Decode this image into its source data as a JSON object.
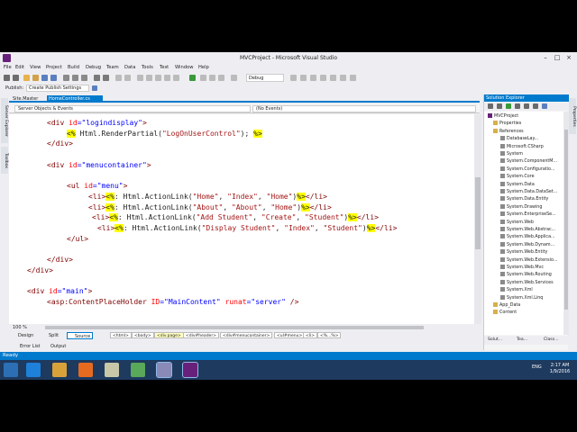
{
  "window": {
    "title": "MVCProject - Microsoft Visual Studio",
    "controls": [
      "–",
      "□",
      "×"
    ]
  },
  "menu": [
    "File",
    "Edit",
    "View",
    "Project",
    "Build",
    "Debug",
    "Team",
    "Data",
    "Tools",
    "Test",
    "Window",
    "Help"
  ],
  "toolbar": {
    "config_value": "Debug",
    "publish_label": "Publish:",
    "publish_profile": "Create Publish Settings"
  },
  "left_strip_tabs": [
    "Server Explorer",
    "Toolbox"
  ],
  "doc_tabs": [
    "Site.Master",
    "HomeController.cs"
  ],
  "navbar": {
    "left": "Server Objects & Events",
    "right": "(No Events)"
  },
  "code": {
    "lines": [
      {
        "tokens": [
          [
            "t",
            "<div "
          ],
          [
            "a",
            "id"
          ],
          [
            "v",
            "=\"logindisplay\""
          ],
          [
            "t",
            ">"
          ]
        ]
      },
      {
        "tokens": [
          [
            "hl",
            "<%"
          ],
          [
            "pl",
            " Html.RenderPartial("
          ],
          [
            "s",
            "\"LogOnUserControl\""
          ],
          [
            "pl",
            "); "
          ],
          [
            "hl",
            "%>"
          ]
        ]
      },
      {
        "tokens": [
          [
            "t",
            "</div>"
          ]
        ]
      },
      {
        "tokens": []
      },
      {
        "tokens": [
          [
            "t",
            "<div "
          ],
          [
            "a",
            "id"
          ],
          [
            "v",
            "=\"menucontainer\""
          ],
          [
            "t",
            ">"
          ]
        ]
      },
      {
        "tokens": []
      },
      {
        "tokens": [
          [
            "t",
            "<ul "
          ],
          [
            "a",
            "id"
          ],
          [
            "v",
            "=\"menu\""
          ],
          [
            "t",
            ">"
          ]
        ]
      },
      {
        "tokens": [
          [
            "t",
            "<li>"
          ],
          [
            "hl",
            "<%"
          ],
          [
            "pl",
            ": Html.ActionLink("
          ],
          [
            "s",
            "\"Home\""
          ],
          [
            "pl",
            ", "
          ],
          [
            "s",
            "\"Index\""
          ],
          [
            "pl",
            ", "
          ],
          [
            "s",
            "\"Home\""
          ],
          [
            "pl",
            ")"
          ],
          [
            "hl",
            "%>"
          ],
          [
            "t",
            "</li>"
          ]
        ]
      },
      {
        "tokens": [
          [
            "t",
            "<li>"
          ],
          [
            "hl",
            "<%"
          ],
          [
            "pl",
            ": Html.ActionLink("
          ],
          [
            "s",
            "\"About\""
          ],
          [
            "pl",
            ", "
          ],
          [
            "s",
            "\"About\""
          ],
          [
            "pl",
            ", "
          ],
          [
            "s",
            "\"Home\""
          ],
          [
            "pl",
            ")"
          ],
          [
            "hl",
            "%>"
          ],
          [
            "t",
            "</li>"
          ]
        ]
      },
      {
        "tokens": [
          [
            "t",
            "<li>"
          ],
          [
            "hl",
            "<%"
          ],
          [
            "pl",
            ": Html.ActionLink("
          ],
          [
            "s",
            "\"Add Student\""
          ],
          [
            "pl",
            ", "
          ],
          [
            "s",
            "\"Create\""
          ],
          [
            "pl",
            ", "
          ],
          [
            "s",
            "\"Student\""
          ],
          [
            "pl",
            ")"
          ],
          [
            "hl",
            "%>"
          ],
          [
            "t",
            "</li>"
          ]
        ]
      },
      {
        "tokens": [
          [
            "t",
            "<li>"
          ],
          [
            "hl",
            "<%"
          ],
          [
            "pl",
            ": Html.ActionLink("
          ],
          [
            "s",
            "\"Display Student\""
          ],
          [
            "pl",
            ", "
          ],
          [
            "s",
            "\"Index\""
          ],
          [
            "pl",
            ", "
          ],
          [
            "s",
            "\"Student\""
          ],
          [
            "pl",
            ")"
          ],
          [
            "hl",
            "%>"
          ],
          [
            "t",
            "</li>"
          ]
        ]
      },
      {
        "tokens": [
          [
            "t",
            "</ul>"
          ]
        ]
      },
      {
        "tokens": []
      },
      {
        "tokens": [
          [
            "t",
            "</div>"
          ]
        ]
      },
      {
        "tokens": [
          [
            "t",
            "</div>"
          ]
        ]
      },
      {
        "tokens": []
      },
      {
        "tokens": [
          [
            "t",
            "<div "
          ],
          [
            "a",
            "id"
          ],
          [
            "v",
            "=\"main\""
          ],
          [
            "t",
            ">"
          ]
        ]
      },
      {
        "tokens": [
          [
            "t",
            "<asp:ContentPlaceHolder "
          ],
          [
            "a",
            "ID"
          ],
          [
            "v",
            "=\"MainContent\""
          ],
          [
            "pl",
            " "
          ],
          [
            "a",
            "runat"
          ],
          [
            "v",
            "=\"server\""
          ],
          [
            "pl",
            " "
          ],
          [
            "t",
            "/>"
          ]
        ]
      }
    ]
  },
  "zoom": "100 %",
  "design_bar": {
    "buttons": [
      "Design",
      "Split",
      "Source"
    ],
    "breadcrumbs": [
      "<html>",
      "<body>",
      "<div.page>",
      "<div#header>",
      "<div#menucontainer>",
      "<ul#menu>",
      "<li>",
      "<%...%>"
    ]
  },
  "bottom_tabs": [
    "Error List",
    "Output"
  ],
  "status": "Ready",
  "solution_explorer": {
    "title": "Solution Explorer",
    "tree": [
      {
        "label": "MVCProject",
        "kind": "project"
      },
      {
        "label": "Properties",
        "kind": "folder"
      },
      {
        "label": "References",
        "kind": "folder"
      },
      {
        "label": "DatabaseLay...",
        "kind": "ref"
      },
      {
        "label": "Microsoft.CSharp",
        "kind": "ref"
      },
      {
        "label": "System",
        "kind": "ref"
      },
      {
        "label": "System.ComponentM...",
        "kind": "ref"
      },
      {
        "label": "System.Configuratio...",
        "kind": "ref"
      },
      {
        "label": "System.Core",
        "kind": "ref"
      },
      {
        "label": "System.Data",
        "kind": "ref"
      },
      {
        "label": "System.Data.DataSet...",
        "kind": "ref"
      },
      {
        "label": "System.Data.Entity",
        "kind": "ref"
      },
      {
        "label": "System.Drawing",
        "kind": "ref"
      },
      {
        "label": "System.EnterpriseSe...",
        "kind": "ref"
      },
      {
        "label": "System.Web",
        "kind": "ref"
      },
      {
        "label": "System.Web.Abstrac...",
        "kind": "ref"
      },
      {
        "label": "System.Web.Applica...",
        "kind": "ref"
      },
      {
        "label": "System.Web.Dynam...",
        "kind": "ref"
      },
      {
        "label": "System.Web.Entity",
        "kind": "ref"
      },
      {
        "label": "System.Web.Extensio...",
        "kind": "ref"
      },
      {
        "label": "System.Web.Mvc",
        "kind": "ref"
      },
      {
        "label": "System.Web.Routing",
        "kind": "ref"
      },
      {
        "label": "System.Web.Services",
        "kind": "ref"
      },
      {
        "label": "System.Xml",
        "kind": "ref"
      },
      {
        "label": "System.Xml.Linq",
        "kind": "ref"
      },
      {
        "label": "App_Data",
        "kind": "folder"
      },
      {
        "label": "Content",
        "kind": "folder"
      }
    ],
    "bottom_tabs": [
      "Solut...",
      "Tea...",
      "Class..."
    ]
  },
  "right_strip_tabs": [
    "Properties"
  ],
  "taskbar": {
    "tray": [
      "ENG"
    ],
    "time": "2:17 AM",
    "date": "1/9/2016"
  },
  "colors": {
    "accent": "#007acc",
    "tag": "#800000",
    "attr": "#ff0000",
    "value": "#0000ff",
    "string": "#a31515",
    "server_block": "#ffff00"
  }
}
